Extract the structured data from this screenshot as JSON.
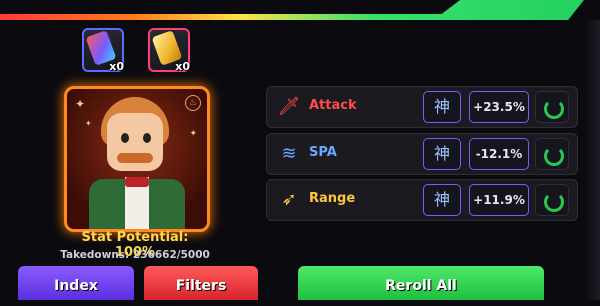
{
  "inventory": {
    "items": [
      {
        "icon": "stat-reroll-rainbow-icon",
        "count": "x0"
      },
      {
        "icon": "stat-reroll-gold-icon",
        "count": "x0"
      }
    ]
  },
  "unit": {
    "portrait_icon": "character-portrait",
    "stat_potential": "Stat Potential: 100%",
    "takedowns": "Takedowns: 236662/5000"
  },
  "stats": [
    {
      "label": "Attack",
      "icon": "sword-icon",
      "rank": "神",
      "value": "+23.5%",
      "label_color": "#ff4b4b"
    },
    {
      "label": "SPA",
      "icon": "slash-icon",
      "rank": "神",
      "value": "-12.1%",
      "label_color": "#6aa8ff"
    },
    {
      "label": "Range",
      "icon": "bow-icon",
      "rank": "神",
      "value": "+11.9%",
      "label_color": "#ffc83a"
    }
  ],
  "buttons": {
    "index": "Index",
    "filters": "Filters",
    "reroll_all": "Reroll All"
  },
  "colors": {
    "accent_orange": "#ff8a1f",
    "reroll_green": "#28c850",
    "rank_border": "#7a5cff"
  }
}
